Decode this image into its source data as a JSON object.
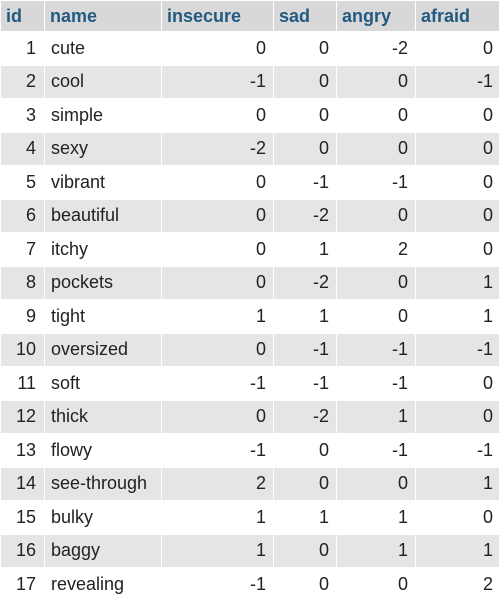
{
  "table": {
    "columns": [
      "id",
      "name",
      "insecure",
      "sad",
      "angry",
      "afraid"
    ],
    "rows": [
      {
        "id": "1",
        "name": "cute",
        "insecure": "0",
        "sad": "0",
        "angry": "-2",
        "afraid": "0"
      },
      {
        "id": "2",
        "name": "cool",
        "insecure": "-1",
        "sad": "0",
        "angry": "0",
        "afraid": "-1"
      },
      {
        "id": "3",
        "name": "simple",
        "insecure": "0",
        "sad": "0",
        "angry": "0",
        "afraid": "0"
      },
      {
        "id": "4",
        "name": "sexy",
        "insecure": "-2",
        "sad": "0",
        "angry": "0",
        "afraid": "0"
      },
      {
        "id": "5",
        "name": "vibrant",
        "insecure": "0",
        "sad": "-1",
        "angry": "-1",
        "afraid": "0"
      },
      {
        "id": "6",
        "name": "beautiful",
        "insecure": "0",
        "sad": "-2",
        "angry": "0",
        "afraid": "0"
      },
      {
        "id": "7",
        "name": "itchy",
        "insecure": "0",
        "sad": "1",
        "angry": "2",
        "afraid": "0"
      },
      {
        "id": "8",
        "name": "pockets",
        "insecure": "0",
        "sad": "-2",
        "angry": "0",
        "afraid": "1"
      },
      {
        "id": "9",
        "name": "tight",
        "insecure": "1",
        "sad": "1",
        "angry": "0",
        "afraid": "1"
      },
      {
        "id": "10",
        "name": "oversized",
        "insecure": "0",
        "sad": "-1",
        "angry": "-1",
        "afraid": "-1"
      },
      {
        "id": "11",
        "name": "soft",
        "insecure": "-1",
        "sad": "-1",
        "angry": "-1",
        "afraid": "0"
      },
      {
        "id": "12",
        "name": "thick",
        "insecure": "0",
        "sad": "-2",
        "angry": "1",
        "afraid": "0"
      },
      {
        "id": "13",
        "name": "flowy",
        "insecure": "-1",
        "sad": "0",
        "angry": "-1",
        "afraid": "-1"
      },
      {
        "id": "14",
        "name": "see-through",
        "insecure": "2",
        "sad": "0",
        "angry": "0",
        "afraid": "1"
      },
      {
        "id": "15",
        "name": "bulky",
        "insecure": "1",
        "sad": "1",
        "angry": "1",
        "afraid": "0"
      },
      {
        "id": "16",
        "name": "baggy",
        "insecure": "1",
        "sad": "0",
        "angry": "1",
        "afraid": "1"
      },
      {
        "id": "17",
        "name": "revealing",
        "insecure": "-1",
        "sad": "0",
        "angry": "0",
        "afraid": "2"
      }
    ]
  },
  "colors": {
    "header_bg": "#d8d8d8",
    "header_text": "#235a81",
    "row_even_bg": "#e5e5e5",
    "row_odd_bg": "#ffffff",
    "cell_text": "#222222"
  }
}
